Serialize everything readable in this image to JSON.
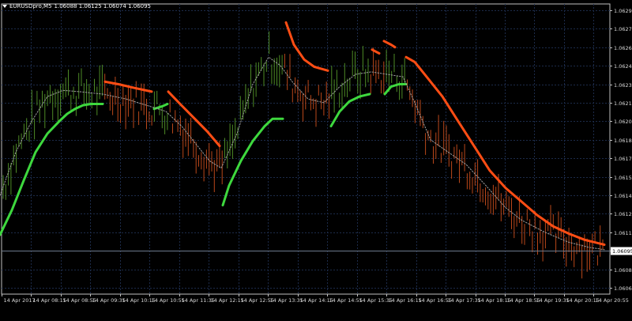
{
  "header": {
    "symbol": "EURUSDpro,M5",
    "ohlc": "1.06088 1.06125 1.06074 1.06095"
  },
  "colors": {
    "background": "#000000",
    "grid": "#1c2b4a",
    "axis": "#c0c0c0",
    "bull": "#4d8a26",
    "bear": "#b9471a",
    "ma_up": "#3ed83e",
    "ma_down": "#ff4d14",
    "ma_mid": "#a0a0a0",
    "price_line": "#6c7a8c"
  },
  "chart_data": {
    "type": "line",
    "symbol": "EURUSDpro,M5",
    "ylim": [
      1.0606,
      1.06295
    ],
    "y_ticks": [
      "1.06290",
      "1.06275",
      "1.06260",
      "1.06245",
      "1.06230",
      "1.06215",
      "1.06200",
      "1.06185",
      "1.06170",
      "1.06155",
      "1.06140",
      "1.06125",
      "1.06110",
      "1.06095",
      "1.06080",
      "1.06065"
    ],
    "x_ticks": [
      "14 Apr 2017",
      "14 Apr 08:15",
      "14 Apr 08:55",
      "14 Apr 09:35",
      "14 Apr 10:15",
      "14 Apr 10:55",
      "14 Apr 11:35",
      "14 Apr 12:15",
      "14 Apr 12:55",
      "14 Apr 13:35",
      "14 Apr 14:15",
      "14 Apr 14:55",
      "14 Apr 15:35",
      "14 Apr 16:15",
      "14 Apr 16:55",
      "14 Apr 17:35",
      "14 Apr 18:15",
      "14 Apr 18:55",
      "14 Apr 19:35",
      "14 Apr 20:15",
      "14 Apr 20:55"
    ],
    "current_price": "1.06095",
    "series": [
      {
        "name": "",
        "color": "#3ed83e",
        "segments": [
          [
            [
              0,
              1.06108
            ],
            [
              15,
              1.06128
            ],
            [
              30,
              1.06152
            ],
            [
              45,
              1.06175
            ],
            [
              60,
              1.0619
            ],
            [
              75,
              1.062
            ],
            [
              85,
              1.06206
            ],
            [
              95,
              1.0621
            ],
            [
              105,
              1.06213
            ],
            [
              115,
              1.06214
            ],
            [
              130,
              1.06214
            ]
          ],
          [
            [
              195,
              1.0621
            ],
            [
              205,
              1.06212
            ],
            [
              212,
              1.06214
            ]
          ],
          [
            [
              282,
              1.06132
            ],
            [
              290,
              1.06148
            ],
            [
              305,
              1.06168
            ],
            [
              320,
              1.06184
            ],
            [
              335,
              1.06196
            ],
            [
              345,
              1.06202
            ],
            [
              358,
              1.06202
            ]
          ],
          [
            [
              419,
              1.06196
            ],
            [
              430,
              1.06208
            ],
            [
              442,
              1.06216
            ],
            [
              455,
              1.0622
            ],
            [
              468,
              1.06222
            ]
          ],
          [
            [
              487,
              1.06222
            ],
            [
              495,
              1.06228
            ],
            [
              505,
              1.0623
            ],
            [
              514,
              1.0623
            ]
          ]
        ]
      },
      {
        "name": "",
        "color": "#ff4d14",
        "segments": [
          [
            [
              133,
              1.06232
            ],
            [
              150,
              1.0623
            ],
            [
              170,
              1.06227
            ],
            [
              192,
              1.06224
            ]
          ],
          [
            [
              213,
              1.06224
            ],
            [
              228,
              1.06214
            ],
            [
              245,
              1.06203
            ],
            [
              262,
              1.06192
            ],
            [
              278,
              1.0618
            ]
          ],
          [
            [
              362,
              1.0628
            ],
            [
              372,
              1.06262
            ],
            [
              385,
              1.0625
            ],
            [
              398,
              1.06244
            ],
            [
              415,
              1.06241
            ]
          ],
          [
            [
              471,
              1.06258
            ],
            [
              480,
              1.06255
            ]
          ],
          [
            [
              486,
              1.06265
            ],
            [
              495,
              1.06262
            ],
            [
              500,
              1.0626
            ]
          ],
          [
            [
              514,
              1.06252
            ],
            [
              525,
              1.06248
            ],
            [
              540,
              1.06236
            ],
            [
              560,
              1.0622
            ],
            [
              580,
              1.062
            ],
            [
              600,
              1.0618
            ],
            [
              620,
              1.0616
            ],
            [
              640,
              1.06146
            ],
            [
              660,
              1.06135
            ],
            [
              680,
              1.06124
            ],
            [
              700,
              1.06115
            ],
            [
              720,
              1.06109
            ],
            [
              740,
              1.06104
            ],
            [
              765,
              1.061
            ]
          ]
        ]
      },
      {
        "name": "",
        "color": "#a0a0a0",
        "segments": [
          [
            [
              0,
              1.0614
            ],
            [
              20,
              1.06175
            ],
            [
              40,
              1.062
            ],
            [
              60,
              1.0622
            ],
            [
              80,
              1.06225
            ],
            [
              100,
              1.06224
            ],
            [
              130,
              1.06222
            ],
            [
              160,
              1.06218
            ],
            [
              190,
              1.06212
            ],
            [
              210,
              1.06208
            ],
            [
              230,
              1.06196
            ],
            [
              250,
              1.0618
            ],
            [
              265,
              1.06168
            ],
            [
              280,
              1.06162
            ],
            [
              300,
              1.0619
            ],
            [
              320,
              1.0623
            ],
            [
              340,
              1.06252
            ],
            [
              355,
              1.06245
            ],
            [
              370,
              1.06232
            ],
            [
              390,
              1.06218
            ],
            [
              410,
              1.06215
            ],
            [
              430,
              1.06228
            ],
            [
              450,
              1.06238
            ],
            [
              470,
              1.0624
            ],
            [
              490,
              1.06238
            ],
            [
              510,
              1.06236
            ],
            [
              525,
              1.06215
            ],
            [
              545,
              1.06185
            ],
            [
              565,
              1.06176
            ],
            [
              590,
              1.06165
            ],
            [
              615,
              1.06148
            ],
            [
              640,
              1.0613
            ],
            [
              660,
              1.0612
            ],
            [
              690,
              1.0611
            ],
            [
              720,
              1.06102
            ],
            [
              745,
              1.06098
            ],
            [
              765,
              1.06096
            ]
          ]
        ]
      }
    ]
  }
}
